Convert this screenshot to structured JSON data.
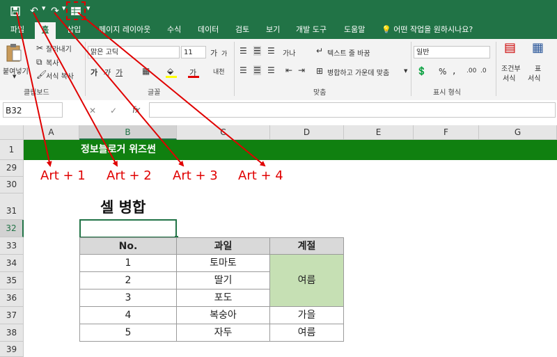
{
  "qat": {
    "save": "save-icon",
    "undo": "undo-icon",
    "redo": "redo-icon",
    "merge": "merge-cells-icon"
  },
  "tabs": [
    "파일",
    "홈",
    "삽입",
    "페이지 레이아웃",
    "수식",
    "데이터",
    "검토",
    "보기",
    "개발 도구",
    "도움말",
    "어떤 작업을 원하시나요?"
  ],
  "ribbon": {
    "clipboard": {
      "paste": "붙여넣기",
      "cut": "잘라내기",
      "copy": "복사",
      "format_painter": "서식 복사",
      "group": "클립보드"
    },
    "font": {
      "name": "맑은 고딕",
      "size": "11",
      "group": "글꼴",
      "bold": "가",
      "italic": "가",
      "underline": "가",
      "grow": "가",
      "shrink": "가",
      "font_color": "가",
      "phonetic": "내천"
    },
    "alignment": {
      "wrap": "텍스트 줄 바꿈",
      "merge": "병합하고 가운데 맞춤",
      "group": "맞춤",
      "vertical_text": "가나"
    },
    "number": {
      "format": "일반",
      "group": "표시 형식",
      "percent": "%",
      "comma": ","
    },
    "styles": {
      "conditional_line1": "조건부",
      "conditional_line2": "서식",
      "table_line1": "표",
      "table_line2": "서식"
    }
  },
  "formula_bar": {
    "name_box": "B32",
    "cancel": "✕",
    "enter": "✓",
    "fx": "fx",
    "value": ""
  },
  "columns": [
    "A",
    "B",
    "C",
    "D",
    "E",
    "F",
    "G"
  ],
  "rows": [
    "1",
    "29",
    "30",
    "31",
    "32",
    "33",
    "34",
    "35",
    "36",
    "37",
    "38",
    "39"
  ],
  "banner": "정보블로거 위즈썬",
  "shortcuts": [
    "Art + 1",
    "Art + 2",
    "Art + 3",
    "Art + 4"
  ],
  "heading": "셀 병합",
  "table": {
    "headers": [
      "No.",
      "과일",
      "계절"
    ],
    "rows": [
      {
        "no": "1",
        "fruit": "토마토"
      },
      {
        "no": "2",
        "fruit": "딸기"
      },
      {
        "no": "3",
        "fruit": "포도"
      },
      {
        "no": "4",
        "fruit": "복숭아",
        "season": "가을"
      },
      {
        "no": "5",
        "fruit": "자두",
        "season": "여름"
      }
    ],
    "merged_season": "여름"
  },
  "colors": {
    "excel_green": "#217346",
    "banner_green": "#108010",
    "merged_fill": "#c6e0b4",
    "header_fill": "#d9d9d9",
    "annotation_red": "#e00000"
  }
}
